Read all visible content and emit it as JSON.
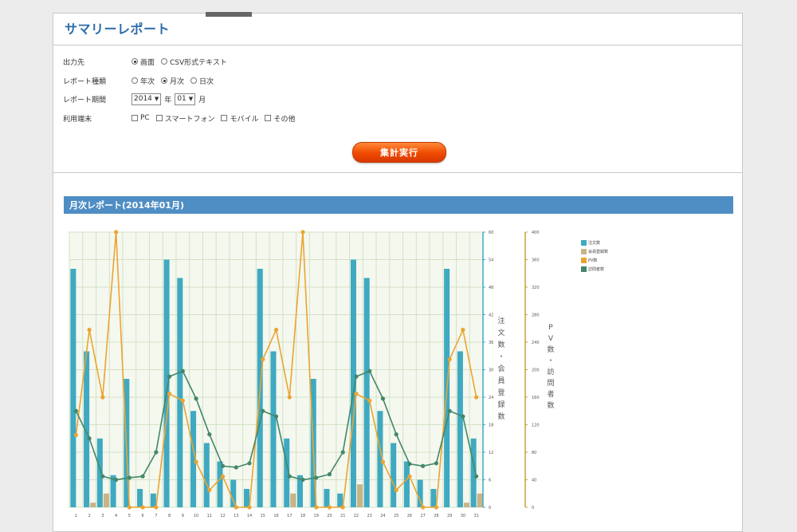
{
  "page_title": "サマリーレポート",
  "form": {
    "output": {
      "label": "出力先",
      "options": [
        {
          "label": "画面",
          "selected": true
        },
        {
          "label": "CSV形式テキスト",
          "selected": false
        }
      ]
    },
    "report_type": {
      "label": "レポート種類",
      "options": [
        {
          "label": "年次",
          "selected": false
        },
        {
          "label": "月次",
          "selected": true
        },
        {
          "label": "日次",
          "selected": false
        }
      ]
    },
    "period": {
      "label": "レポート期間",
      "year_value": "2014",
      "year_unit": "年",
      "month_value": "01",
      "month_unit": "月"
    },
    "device": {
      "label": "利用端末",
      "options": [
        {
          "label": "PC",
          "checked": false
        },
        {
          "label": "スマートフォン",
          "checked": false
        },
        {
          "label": "モバイル",
          "checked": false
        },
        {
          "label": "その他",
          "checked": false
        }
      ]
    }
  },
  "run_button_label": "集計実行",
  "report_title": "月次レポート(2014年01月)",
  "chart_data": {
    "type": "bar",
    "x": [
      1,
      2,
      3,
      4,
      5,
      6,
      7,
      8,
      9,
      10,
      11,
      12,
      13,
      14,
      15,
      16,
      17,
      18,
      19,
      20,
      21,
      22,
      23,
      24,
      25,
      26,
      27,
      28,
      29,
      30,
      31
    ],
    "left_axis": {
      "label": "注文数・会員登録数",
      "ylim": [
        0,
        60
      ],
      "ticks": [
        0,
        6,
        12,
        18,
        24,
        30,
        36,
        42,
        48,
        54,
        60
      ]
    },
    "right_axis": {
      "label": "PV数・訪問者数",
      "ylim": [
        0,
        400
      ],
      "ticks": [
        0,
        40,
        80,
        120,
        160,
        200,
        240,
        280,
        320,
        360,
        400
      ]
    },
    "series": [
      {
        "name": "注文数",
        "type": "bar",
        "axis": "left",
        "color": "#3fa9c1",
        "values": [
          52,
          34,
          15,
          7,
          28,
          4,
          3,
          54,
          50,
          21,
          14,
          10,
          6,
          4,
          52,
          34,
          15,
          7,
          28,
          4,
          3,
          54,
          50,
          21,
          14,
          10,
          6,
          4,
          52,
          34,
          15
        ]
      },
      {
        "name": "会員登録数",
        "type": "bar",
        "axis": "left",
        "color": "#c8b487",
        "values": [
          0,
          1,
          3,
          0,
          0,
          0,
          0,
          0,
          0,
          0,
          0,
          0,
          0,
          0,
          0,
          0,
          3,
          0,
          0,
          0,
          0,
          5,
          0,
          0,
          0,
          0,
          0,
          0,
          0,
          1,
          3
        ]
      },
      {
        "name": "PV数",
        "type": "line",
        "axis": "right",
        "color": "#eba431",
        "values": [
          105,
          258,
          160,
          400,
          0,
          0,
          0,
          165,
          155,
          66,
          25,
          45,
          0,
          0,
          215,
          258,
          160,
          400,
          0,
          0,
          0,
          165,
          155,
          66,
          25,
          45,
          0,
          0,
          215,
          258,
          160
        ]
      },
      {
        "name": "訪問者数",
        "type": "line",
        "axis": "right",
        "color": "#43876a",
        "values": [
          140,
          100,
          45,
          40,
          43,
          45,
          80,
          190,
          198,
          158,
          106,
          60,
          58,
          64,
          140,
          132,
          45,
          40,
          43,
          48,
          80,
          190,
          198,
          158,
          106,
          63,
          60,
          64,
          140,
          132,
          45
        ]
      }
    ],
    "grid": true,
    "legend_position": "top-right"
  }
}
